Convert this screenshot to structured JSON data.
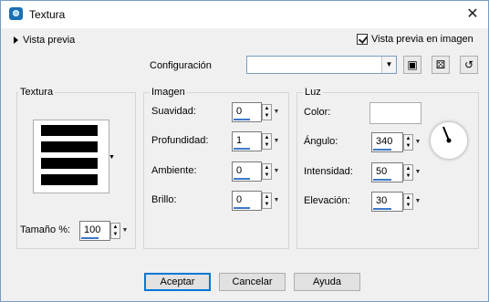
{
  "window": {
    "title": "Textura"
  },
  "top": {
    "preview_toggle_label": "Vista previa",
    "preview_checkbox_label": "Vista previa en imagen",
    "preview_checkbox_checked": true,
    "config_label": "Configuración",
    "config_value": ""
  },
  "textura": {
    "group_label": "Textura",
    "size_label": "Tamaño %:",
    "size_value": "100"
  },
  "imagen": {
    "group_label": "Imagen",
    "suavidad_label": "Suavidad:",
    "suavidad_value": "0",
    "profundidad_label": "Profundidad:",
    "profundidad_value": "1",
    "ambiente_label": "Ambiente:",
    "ambiente_value": "0",
    "brillo_label": "Brillo:",
    "brillo_value": "0"
  },
  "luz": {
    "group_label": "Luz",
    "color_label": "Color:",
    "color_value": "#ffffff",
    "angulo_label": "Ángulo:",
    "angulo_value": "340",
    "intensidad_label": "Intensidad:",
    "intensidad_value": "50",
    "elevacion_label": "Elevación:",
    "elevacion_value": "30"
  },
  "buttons": {
    "ok": "Aceptar",
    "cancel": "Cancelar",
    "help": "Ayuda"
  },
  "colors": {
    "accent": "#0078d7",
    "field_underline": "#3c78c8"
  }
}
